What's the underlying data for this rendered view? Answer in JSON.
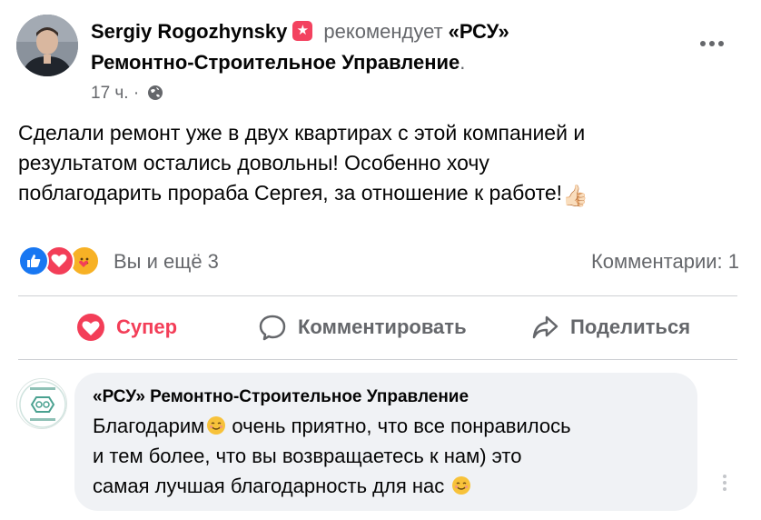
{
  "post": {
    "author": "Sergiy Rogozhynsky",
    "recommendation_icon": "star-recommend-icon",
    "verb": "рекомендует",
    "page_name_line1": "«РСУ»",
    "page_name_line2": "Ремонтно-Строительное Управление",
    "period": ".",
    "time": "17 ч.",
    "separator": "·",
    "privacy_icon": "globe-icon",
    "text_lines": [
      "Сделали ремонт уже в двух квартирах с этой компанией и",
      "результатом остались довольны! Особенно хочу",
      "поблагодарить прораба Сергея, за отношение к работе!"
    ],
    "emoji": "👍🏻"
  },
  "stats": {
    "reactions_text": "Вы и ещё 3",
    "comments_text": "Комментарии: 1",
    "reaction_icons": [
      "like-icon",
      "love-icon",
      "care-icon"
    ]
  },
  "actions": {
    "super_label": "Супер",
    "comment_label": "Комментировать",
    "share_label": "Поделиться"
  },
  "comment": {
    "author": "«РСУ» Ремонтно-Строительное Управление",
    "lines": [
      "Благодарим",
      "очень приятно, что все понравилось",
      "и тем более, что вы возвращаетесь к нам) это",
      "самая лучшая благодарность для нас"
    ]
  },
  "colors": {
    "accent_blue": "#1877f2",
    "love_red": "#f33e58",
    "care_yellow": "#f7b125",
    "secondary_text": "#65676b",
    "bubble_bg": "#f0f2f5"
  }
}
